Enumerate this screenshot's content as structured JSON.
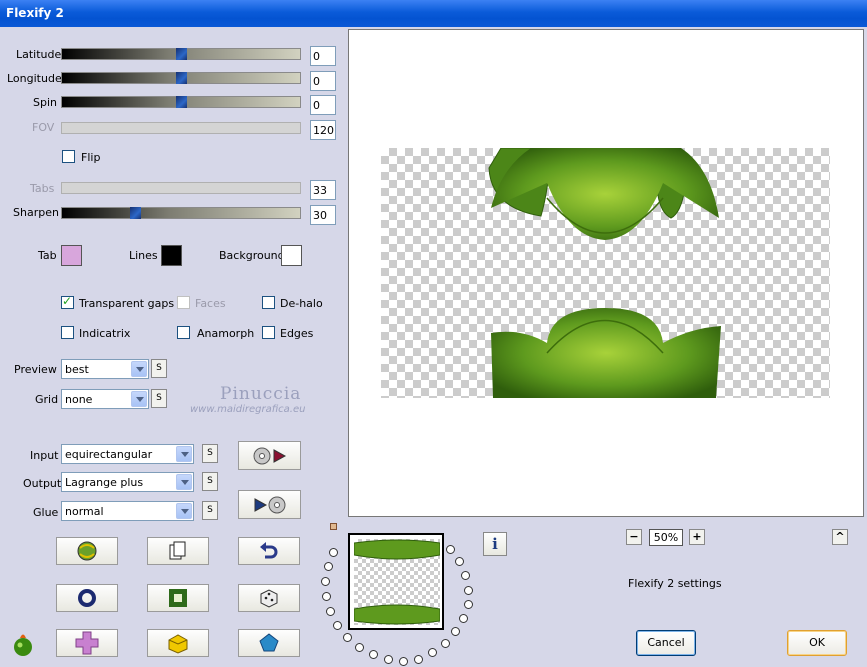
{
  "window": {
    "title": "Flexify 2"
  },
  "sliders": [
    {
      "id": "latitude",
      "label": "Latitude",
      "value": "0",
      "position": 0.5,
      "enabled": true
    },
    {
      "id": "longitude",
      "label": "Longitude",
      "value": "0",
      "position": 0.5,
      "enabled": true
    },
    {
      "id": "spin",
      "label": "Spin",
      "value": "0",
      "position": 0.5,
      "enabled": true
    },
    {
      "id": "fov",
      "label": "FOV",
      "value": "120",
      "enabled": false
    },
    {
      "id": "tabs",
      "label": "Tabs",
      "value": "33",
      "enabled": false
    },
    {
      "id": "sharpen",
      "label": "Sharpen",
      "value": "30",
      "position": 0.3,
      "enabled": true
    }
  ],
  "flip": {
    "label": "Flip",
    "checked": false
  },
  "colors": {
    "tab": {
      "label": "Tab",
      "color": "#d8a6dc"
    },
    "lines": {
      "label": "Lines",
      "color": "#000000"
    },
    "background": {
      "label": "Background",
      "color": "#ffffff"
    }
  },
  "options": {
    "transparent_gaps": {
      "label": "Transparent gaps",
      "checked": true
    },
    "faces": {
      "label": "Faces",
      "checked": false,
      "enabled": false
    },
    "de_halo": {
      "label": "De-halo",
      "checked": false
    },
    "indicatrix": {
      "label": "Indicatrix",
      "checked": false
    },
    "anamorph": {
      "label": "Anamorph",
      "checked": false
    },
    "edges": {
      "label": "Edges",
      "checked": false
    }
  },
  "selects": {
    "preview": {
      "label": "Preview",
      "value": "best"
    },
    "grid": {
      "label": "Grid",
      "value": "none"
    },
    "input": {
      "label": "Input",
      "value": "equirectangular"
    },
    "output": {
      "label": "Output",
      "value": "Lagrange plus"
    },
    "glue": {
      "label": "Glue",
      "value": "normal"
    }
  },
  "s_button_label": "S",
  "watermark": {
    "line1": "Pinuccia",
    "line2": "www.maidiregrafica.eu"
  },
  "zoom": {
    "value": "50%",
    "minus": "−",
    "plus": "+"
  },
  "up_button_label": "^",
  "settings_name": "Flexify 2 settings",
  "info_label": "i",
  "buttons": {
    "cancel": "Cancel",
    "ok": "OK"
  },
  "accent": {
    "green_dark": "#3d6d0c",
    "green_light": "#7ab82a",
    "title_blue": "#0a5bd9"
  }
}
